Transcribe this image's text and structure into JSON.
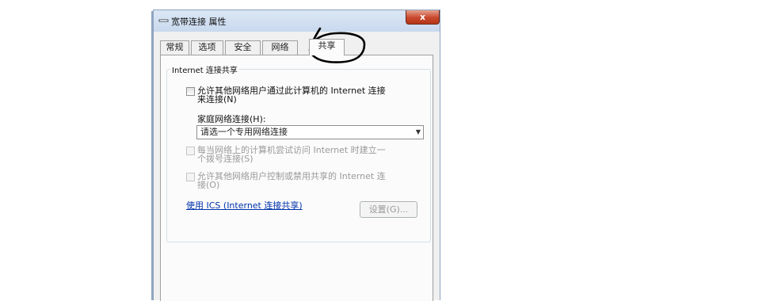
{
  "window": {
    "title": "宽带连接 属性",
    "close_label": "x"
  },
  "tabs": [
    {
      "label": "常规",
      "active": false
    },
    {
      "label": "选项",
      "active": false
    },
    {
      "label": "安全",
      "active": false
    },
    {
      "label": "网络",
      "active": false
    },
    {
      "label": "共享",
      "active": true
    }
  ],
  "sharing": {
    "group_title": "Internet 连接共享",
    "allow_connect": {
      "line1": "允许其他网络用户通过此计算机的 Internet 连接",
      "line2": "来连接(N)",
      "checked": false,
      "enabled": true
    },
    "home_network_label": "家庭网络连接(H):",
    "home_network_value": "请选一个专用网络连接",
    "dial_on_demand": {
      "line1": "每当网络上的计算机尝试访问 Internet 时建立一",
      "line2": "个拨号连接(S)",
      "checked": false,
      "enabled": false
    },
    "allow_control": {
      "line1": "允许其他网络用户控制或禁用共享的 Internet 连",
      "line2": "接(O)",
      "checked": false,
      "enabled": false
    },
    "ics_link": "使用 ICS (Internet 连接共享)",
    "settings_button": "设置(G)...",
    "settings_enabled": false
  },
  "colors": {
    "link": "#0033aa",
    "annotation_stroke": "#000000",
    "close_button": "#c9472d"
  }
}
